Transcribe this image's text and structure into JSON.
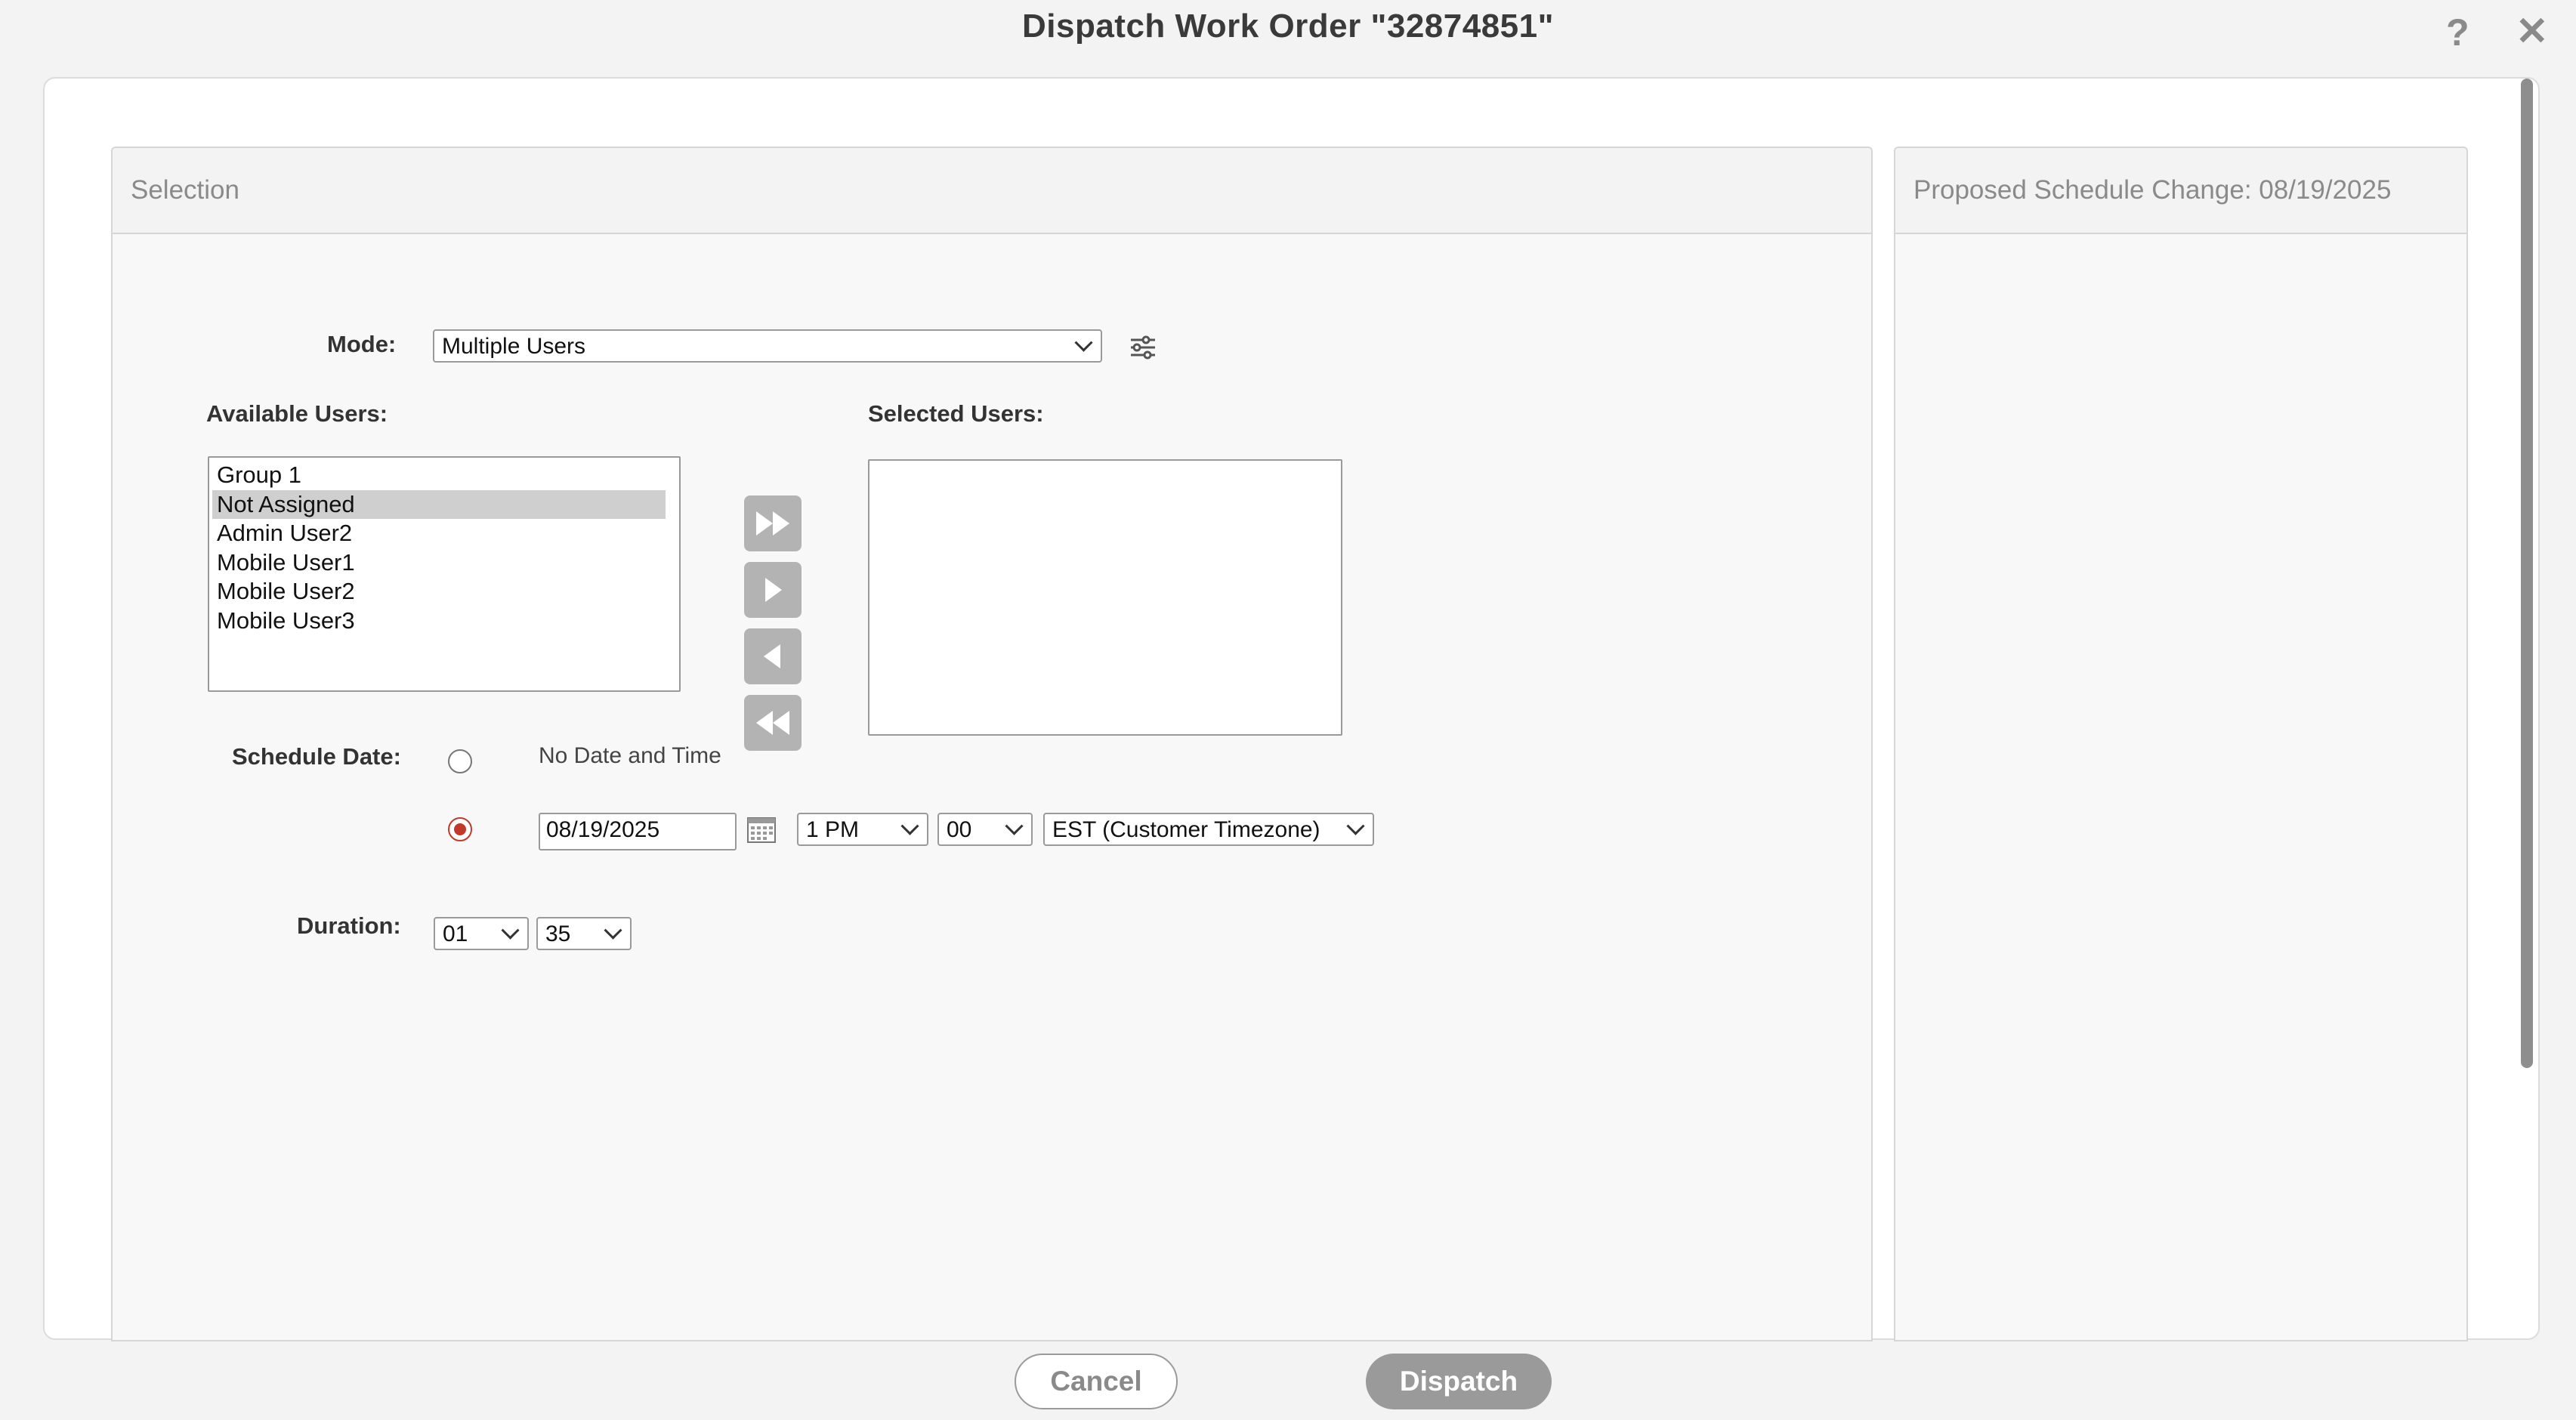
{
  "window": {
    "title": "Dispatch Work Order  \"32874851\"",
    "help_icon": "?",
    "close_icon": "✕"
  },
  "selection_panel": {
    "title": "Selection",
    "mode": {
      "label": "Mode:",
      "value": "Multiple Users",
      "settings_icon": "sliders-icon"
    },
    "available_users": {
      "label": "Available Users:",
      "items": [
        "Group 1",
        "Not Assigned",
        "Admin User2",
        "Mobile User1",
        "Mobile User2",
        "Mobile User3"
      ],
      "selected_item": "Not Assigned"
    },
    "selected_users": {
      "label": "Selected Users:",
      "items": []
    },
    "transfer_buttons": [
      "move-all-right",
      "move-right",
      "move-left",
      "move-all-left"
    ],
    "schedule_date": {
      "label": "Schedule Date:",
      "option_none_label": "No Date and Time",
      "option_date_selected": true,
      "date_value": "08/19/2025",
      "hour_value": "1 PM",
      "minute_value": "00",
      "timezone_value": "EST (Customer Timezone)"
    },
    "duration": {
      "label": "Duration:",
      "hours_value": "01",
      "minutes_value": "35"
    }
  },
  "proposed_panel": {
    "title": "Proposed Schedule Change: 08/19/2025"
  },
  "footer": {
    "cancel_label": "Cancel",
    "dispatch_label": "Dispatch"
  },
  "colors": {
    "radio_selected": "#c0392b",
    "dispatch_button": "#9a9a9a",
    "list_selection": "#cfcfcf"
  }
}
